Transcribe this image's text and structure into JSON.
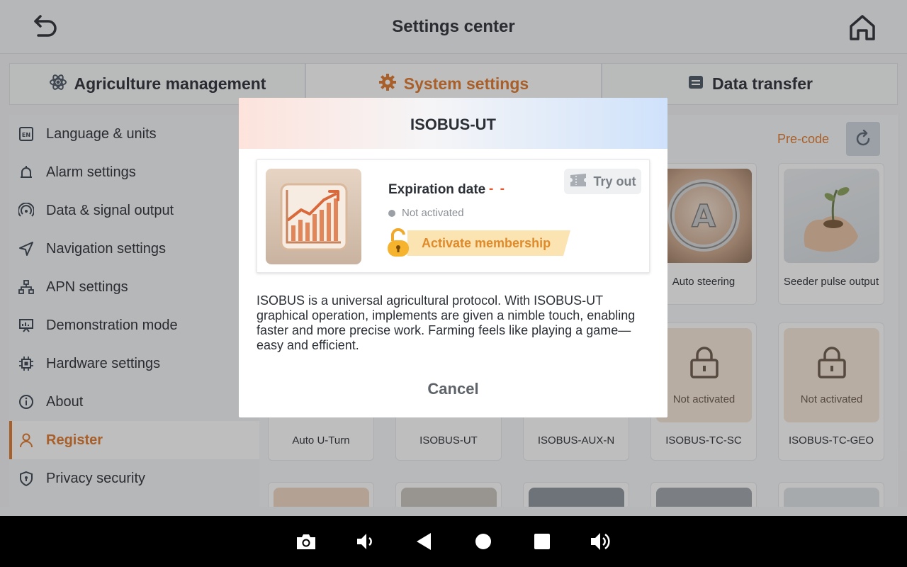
{
  "header": {
    "title": "Settings center",
    "back_icon": "back-arrow-icon",
    "home_icon": "home-icon"
  },
  "tabs": [
    {
      "label": "Agriculture management",
      "icon": "atom-icon",
      "active": false
    },
    {
      "label": "System settings",
      "icon": "gear-icon",
      "active": true
    },
    {
      "label": "Data transfer",
      "icon": "database-icon",
      "active": false
    }
  ],
  "sidebar": {
    "items": [
      {
        "label": "Language & units",
        "icon": "language-en-icon"
      },
      {
        "label": "Alarm settings",
        "icon": "alarm-bell-icon"
      },
      {
        "label": "Data & signal output",
        "icon": "signal-icon"
      },
      {
        "label": "Navigation settings",
        "icon": "navigation-arrow-icon"
      },
      {
        "label": "APN settings",
        "icon": "network-tree-icon"
      },
      {
        "label": "Demonstration mode",
        "icon": "presentation-board-icon"
      },
      {
        "label": "Hardware settings",
        "icon": "chip-icon"
      },
      {
        "label": "About",
        "icon": "info-icon"
      },
      {
        "label": "Register",
        "icon": "user-icon",
        "active": true
      },
      {
        "label": "Privacy security",
        "icon": "shield-icon"
      }
    ]
  },
  "content": {
    "precode_label": "Pre-code",
    "reset_icon": "refresh-icon",
    "cards": [
      {
        "label": "Auto steering"
      },
      {
        "label": "Seeder pulse output"
      },
      {
        "label": "Not activated"
      },
      {
        "label": "Not activated"
      },
      {
        "label": "Auto U-Turn"
      },
      {
        "label": "ISOBUS-UT"
      },
      {
        "label": "ISOBUS-AUX-N"
      },
      {
        "label": "ISOBUS-TC-SC"
      },
      {
        "label": "ISOBUS-TC-GEO"
      }
    ]
  },
  "dialog": {
    "title": "ISOBUS-UT",
    "expiration_label": "Expiration date",
    "expiration_value": "- -",
    "status": "Not activated",
    "try_label": "Try out",
    "activate_label": "Activate membership",
    "description": "ISOBUS is a universal agricultural protocol. With ISOBUS-UT graphical operation, implements are given a nimble touch, enabling faster and more precise work. Farming feels like playing a game—easy and efficient.",
    "cancel_label": "Cancel"
  },
  "system_nav": {
    "icons": [
      "camera-icon",
      "volume-down-icon",
      "back-triangle-icon",
      "home-circle-icon",
      "recents-square-icon",
      "volume-up-icon"
    ]
  },
  "colors": {
    "accent": "#e0782a",
    "expiration_red": "#e8582a",
    "activate_gold": "#f5c266"
  }
}
